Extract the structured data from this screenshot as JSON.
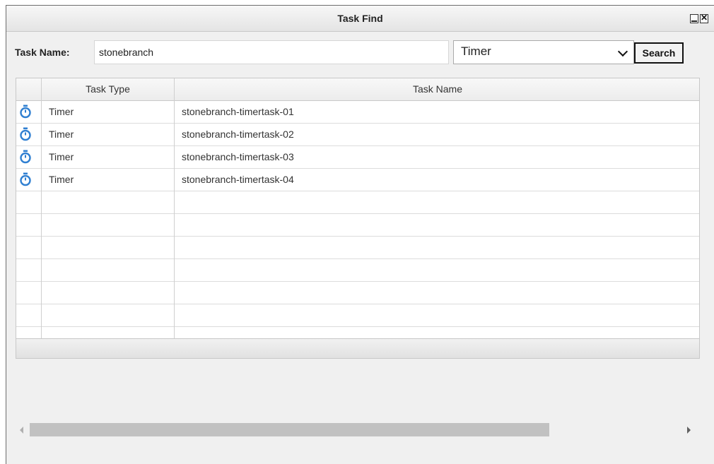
{
  "window": {
    "title": "Task Find",
    "minimize_icon": "minimize-icon",
    "close_icon": "close-icon",
    "close_glyph": "✕"
  },
  "search": {
    "label": "Task Name:",
    "value": "stonebranch",
    "type_selected": "Timer",
    "button_label": "Search"
  },
  "grid": {
    "columns": [
      "Task Type",
      "Task Name"
    ],
    "row_icon": "timer-icon",
    "icon_color": "#2f7fd1",
    "rows": [
      {
        "type": "Timer",
        "name": "stonebranch-timertask-01"
      },
      {
        "type": "Timer",
        "name": "stonebranch-timertask-02"
      },
      {
        "type": "Timer",
        "name": "stonebranch-timertask-03"
      },
      {
        "type": "Timer",
        "name": "stonebranch-timertask-04"
      }
    ],
    "empty_rows": 6
  },
  "scrollbar": {
    "thumb_fraction": 0.79
  }
}
